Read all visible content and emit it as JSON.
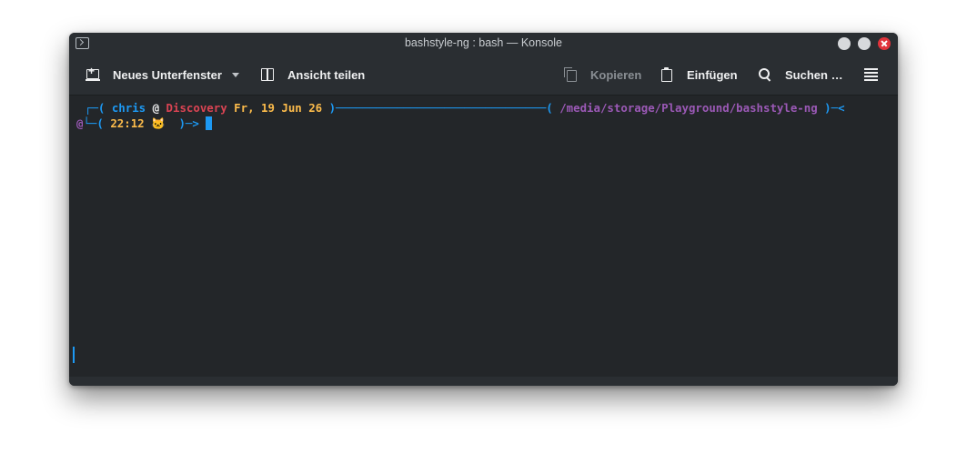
{
  "window": {
    "title": "bashstyle-ng : bash — Konsole"
  },
  "toolbar": {
    "new_tab_label": "Neues Unterfenster",
    "split_view_label": "Ansicht teilen",
    "copy_label": "Kopieren",
    "paste_label": "Einfügen",
    "find_label": "Suchen …"
  },
  "terminal": {
    "line1": {
      "open": "┌─( ",
      "user": "chris",
      "at": " @ ",
      "host": "Discovery",
      "date": " Fr, 19 Jun 26",
      "close_rule": " )───────────────────────────────( ",
      "path": "/media/storage/Playground/bashstyle-ng",
      "end": " )─<"
    },
    "line2": {
      "at": "@",
      "open": "└─( ",
      "time": "22:12",
      "icon": " 🐱 ",
      "close": " )─> "
    }
  },
  "colors": {
    "accent_blue": "#1d99f3",
    "host_red": "#da4453",
    "date_yellow": "#fdbc4b",
    "path_purple": "#9b59b6",
    "close_button": "#e0333b"
  }
}
